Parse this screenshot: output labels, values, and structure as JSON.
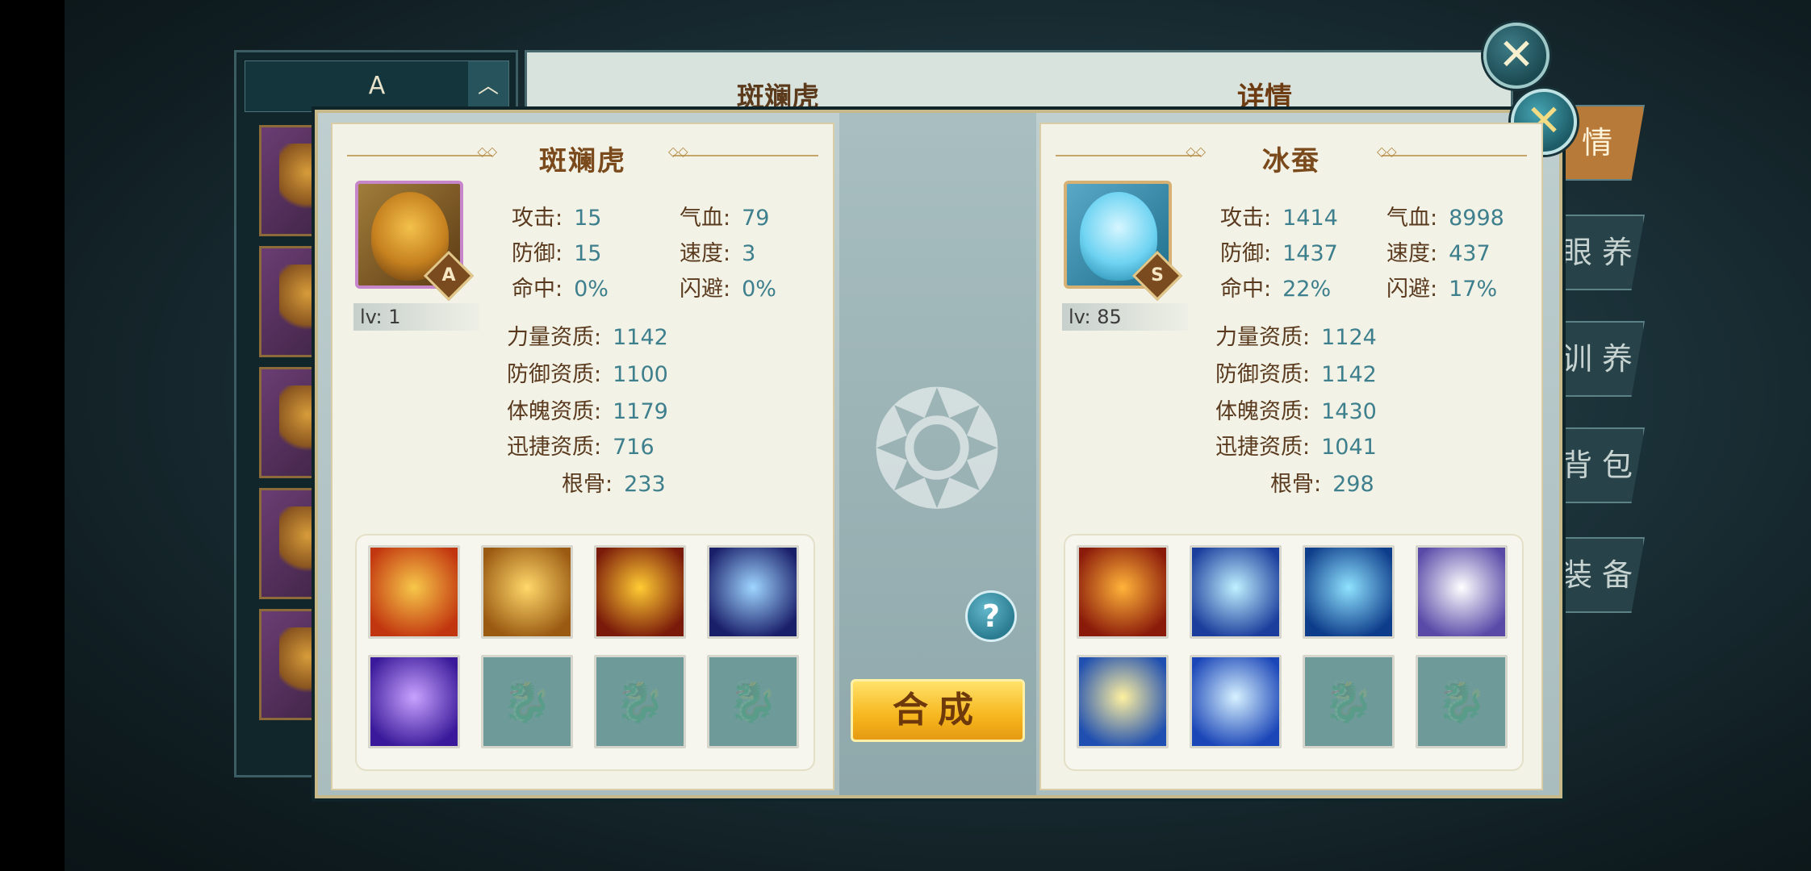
{
  "background": {
    "list_header": "A",
    "list_arrow": "︿",
    "pet_title": "斑斓虎",
    "detail_title": "详情",
    "side_tabs": [
      "情",
      "眼 养",
      "训 养",
      "背 包",
      "装 备"
    ]
  },
  "close_glyph": "✕",
  "center": {
    "help_label": "?",
    "compose_label": "合成"
  },
  "pets": [
    {
      "name": "斑斓虎",
      "rank": "A",
      "level": "lv: 1",
      "stats": [
        {
          "label": "攻击:",
          "value": "15"
        },
        {
          "label": "气血:",
          "value": "79"
        },
        {
          "label": "防御:",
          "value": "15"
        },
        {
          "label": "速度:",
          "value": "3"
        },
        {
          "label": "命中:",
          "value": "0%"
        },
        {
          "label": "闪避:",
          "value": "0%"
        }
      ],
      "aptitudes": [
        {
          "label": "力量资质:",
          "value": "1142"
        },
        {
          "label": "防御资质:",
          "value": "1100"
        },
        {
          "label": "体魄资质:",
          "value": "1179"
        },
        {
          "label": "迅捷资质:",
          "value": "716"
        },
        {
          "label": "根骨:",
          "value": "233"
        }
      ],
      "skills": [
        {
          "icon": "fire-phoenix-skill-icon",
          "colors": [
            "#f7c84a",
            "#c2360f"
          ]
        },
        {
          "icon": "roaring-lion-skill-icon",
          "colors": [
            "#ffd86a",
            "#9a5a12"
          ]
        },
        {
          "icon": "fire-beast-skill-icon",
          "colors": [
            "#ffcc33",
            "#7a1a0a"
          ]
        },
        {
          "icon": "blue-claw-skill-icon",
          "colors": [
            "#9fd6ff",
            "#1a1f6a"
          ]
        },
        {
          "icon": "purple-tornado-skill-icon",
          "colors": [
            "#c9a2ff",
            "#3a1a9a"
          ]
        }
      ]
    },
    {
      "name": "冰蚕",
      "rank": "S",
      "level": "lv: 85",
      "stats": [
        {
          "label": "攻击:",
          "value": "1414"
        },
        {
          "label": "气血:",
          "value": "8998"
        },
        {
          "label": "防御:",
          "value": "1437"
        },
        {
          "label": "速度:",
          "value": "437"
        },
        {
          "label": "命中:",
          "value": "22%"
        },
        {
          "label": "闪避:",
          "value": "17%"
        }
      ],
      "aptitudes": [
        {
          "label": "力量资质:",
          "value": "1124"
        },
        {
          "label": "防御资质:",
          "value": "1142"
        },
        {
          "label": "体魄资质:",
          "value": "1430"
        },
        {
          "label": "迅捷资质:",
          "value": "1041"
        },
        {
          "label": "根骨:",
          "value": "298"
        }
      ],
      "skills": [
        {
          "icon": "fire-orb-skill-icon",
          "colors": [
            "#ffb43a",
            "#8a1a0a"
          ]
        },
        {
          "icon": "blue-speed-skill-icon",
          "colors": [
            "#bff1ff",
            "#1b3d9c"
          ]
        },
        {
          "icon": "blue-heart-skill-icon",
          "colors": [
            "#8fe2ff",
            "#0d3c8a"
          ]
        },
        {
          "icon": "white-orb-skill-icon",
          "colors": [
            "#ffffff",
            "#5a4aa8"
          ]
        },
        {
          "icon": "lightning-skill-icon",
          "colors": [
            "#fff1a0",
            "#1f4fb0"
          ]
        },
        {
          "icon": "blue-arrow-skill-icon",
          "colors": [
            "#d7f2ff",
            "#1b46b8"
          ]
        }
      ]
    }
  ]
}
